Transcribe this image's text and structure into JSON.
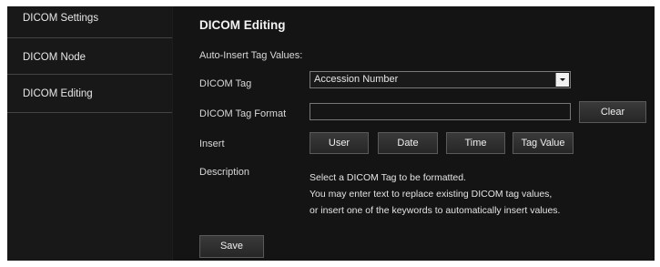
{
  "sidebar": {
    "items": [
      {
        "label": "DICOM Settings"
      },
      {
        "label": "DICOM Node"
      },
      {
        "label": "DICOM Editing"
      }
    ]
  },
  "main": {
    "title": "DICOM Editing",
    "auto_insert_label": "Auto-Insert Tag Values:",
    "dicom_tag_label": "DICOM Tag",
    "dicom_tag_value": "Accession Number",
    "dicom_tag_format_label": "DICOM Tag Format",
    "dicom_tag_format_value": "",
    "clear_label": "Clear",
    "insert_label": "Insert",
    "insert_buttons": [
      "User",
      "Date",
      "Time",
      "Tag Value"
    ],
    "description_label": "Description",
    "description_lines": [
      "Select a DICOM Tag to be formatted.",
      "You may enter text to replace existing DICOM tag values,",
      "or insert one of the keywords to automatically insert values."
    ],
    "save_label": "Save"
  }
}
